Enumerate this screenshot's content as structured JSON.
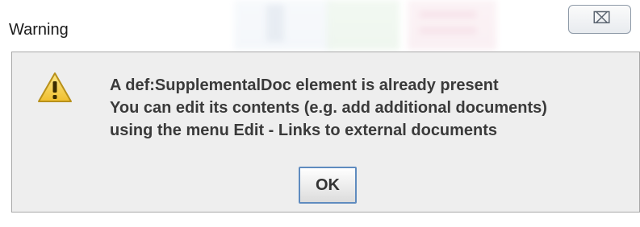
{
  "window": {
    "title": "Warning",
    "close_glyph": "⌧"
  },
  "message": {
    "lines": [
      "A def:SupplementalDoc element is already present",
      "You can edit its contents (e.g. add additional documents)",
      "using the menu Edit - Links to external documents"
    ]
  },
  "buttons": {
    "ok_label": "OK"
  },
  "icons": {
    "warning": "warning-triangle-icon",
    "close": "close-icon"
  },
  "colors": {
    "warning_fill": "#f6d04d",
    "warning_stroke": "#b8901a",
    "ok_border": "#5f8bbf",
    "panel_bg": "#eeeeee"
  }
}
